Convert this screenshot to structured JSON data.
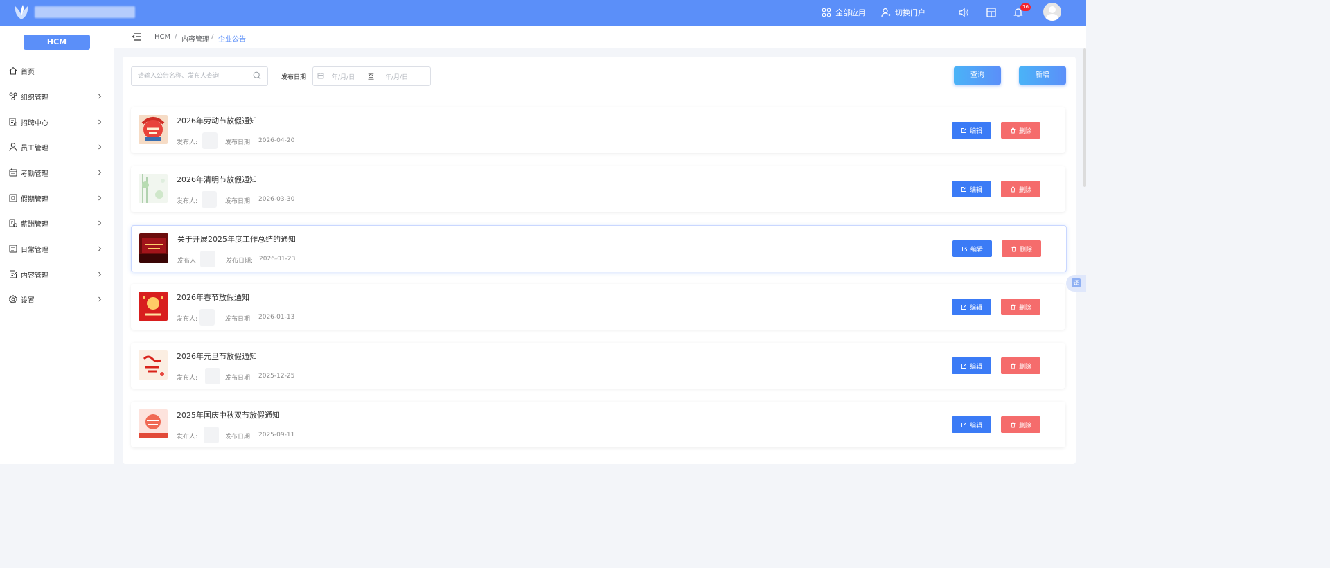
{
  "topbar": {
    "all_apps": "全部应用",
    "switch_portal": "切换门户",
    "notification_count": "16",
    "brand_color": "#5b8ff9"
  },
  "sidebar": {
    "system_button": "HCM",
    "items": [
      {
        "label": "首页",
        "icon": "home-icon",
        "has_children": false
      },
      {
        "label": "组织管理",
        "icon": "org-icon",
        "has_children": true
      },
      {
        "label": "招聘中心",
        "icon": "recruit-icon",
        "has_children": true
      },
      {
        "label": "员工管理",
        "icon": "user-icon",
        "has_children": true
      },
      {
        "label": "考勤管理",
        "icon": "calendar-icon",
        "has_children": true
      },
      {
        "label": "假期管理",
        "icon": "leave-icon",
        "has_children": true
      },
      {
        "label": "薪酬管理",
        "icon": "salary-icon",
        "has_children": true
      },
      {
        "label": "日常管理",
        "icon": "daily-icon",
        "has_children": true
      },
      {
        "label": "内容管理",
        "icon": "content-icon",
        "has_children": true
      },
      {
        "label": "设置",
        "icon": "settings-icon",
        "has_children": true
      }
    ]
  },
  "breadcrumb": {
    "items": [
      "HCM",
      "内容管理",
      "企业公告"
    ],
    "separator": "/"
  },
  "filters": {
    "search_placeholder": "请输入公告名称、发布人查询",
    "date_label": "发布日期",
    "date_start_placeholder": "年/月/日",
    "date_range_separator": "至",
    "date_end_placeholder": "年/月/日",
    "query_button": "查询",
    "add_button": "新增"
  },
  "list": {
    "publisher_label": "发布人:",
    "date_label": "发布日期:",
    "edit_label": "编辑",
    "delete_label": "删除",
    "items": [
      {
        "title": "2026年劳动节放假通知",
        "date": "2026-04-20",
        "thumb": "labor-day"
      },
      {
        "title": "2026年清明节放假通知",
        "date": "2026-03-30",
        "thumb": "qingming"
      },
      {
        "title": "关于开展2025年度工作总结的通知",
        "date": "2026-01-23",
        "thumb": "year-summary"
      },
      {
        "title": "2026年春节放假通知",
        "date": "2026-01-13",
        "thumb": "spring-festival"
      },
      {
        "title": "2026年元旦节放假通知",
        "date": "2025-12-25",
        "thumb": "new-year"
      },
      {
        "title": "2025年国庆中秋双节放假通知",
        "date": "2025-09-11",
        "thumb": "national-day"
      }
    ]
  },
  "colors": {
    "edit": "#3b7bf6",
    "delete": "#f56c6c"
  }
}
